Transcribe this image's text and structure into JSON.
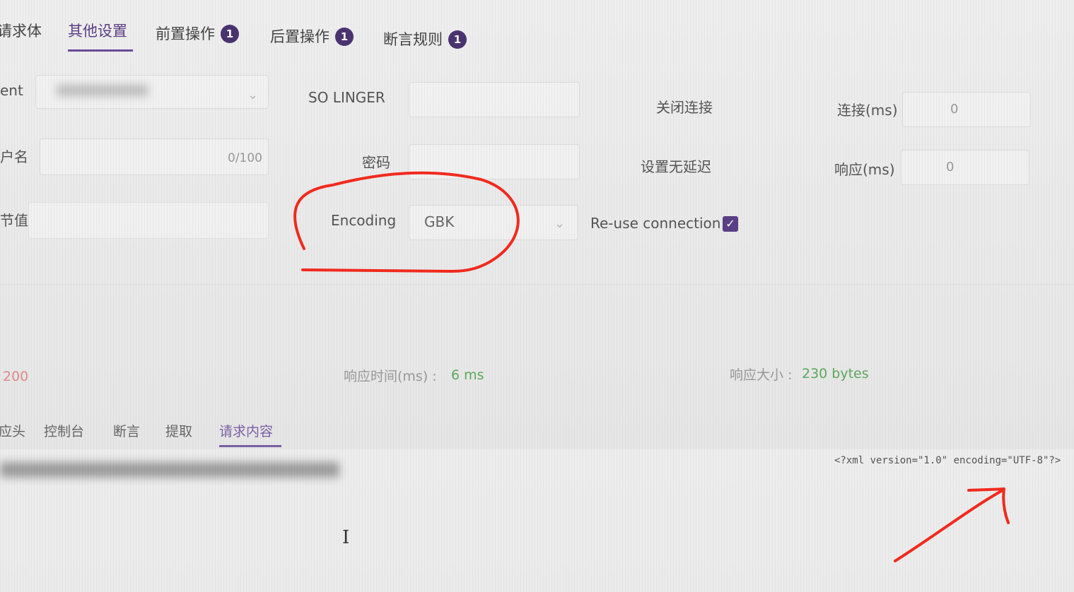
{
  "tabs": [
    {
      "label": "请求体"
    },
    {
      "label": "其他设置"
    },
    {
      "label": "前置操作",
      "badge": "1"
    },
    {
      "label": "后置操作",
      "badge": "1"
    },
    {
      "label": "断言规则",
      "badge": "1"
    }
  ],
  "form": {
    "row1": {
      "left_label": "ent",
      "so_linger_label": "SO LINGER",
      "close_conn_label": "关闭连接",
      "connect_label": "连接(ms)",
      "connect_value": "0"
    },
    "row2": {
      "left_label": "户名",
      "left_counter": "0/100",
      "password_label": "密码",
      "nodelay_label": "设置无延迟",
      "response_label": "响应(ms)",
      "response_value": "0"
    },
    "row3": {
      "left_label": "节值",
      "encoding_label": "Encoding",
      "encoding_value": "GBK",
      "reuse_label": "Re-use connection"
    }
  },
  "stats": {
    "status_code": "200",
    "time_label": "响应时间(ms) :",
    "time_value": "6 ms",
    "size_label": "响应大小 :",
    "size_value": "230 bytes"
  },
  "sub_tabs": [
    {
      "label": "应头"
    },
    {
      "label": "控制台"
    },
    {
      "label": "断言"
    },
    {
      "label": "提取"
    },
    {
      "label": "请求内容"
    }
  ],
  "request_content": {
    "xml_decl": "<?xml version=\"1.0\" encoding=\"UTF-8\"?>"
  },
  "colors": {
    "accent": "#5b3f86",
    "annotation": "#f02a1e",
    "success": "#5ea85e"
  },
  "icons": {
    "dropdown": "chevron-down-icon",
    "check": "checkmark-icon",
    "text_cursor": "ibeam-cursor-icon"
  }
}
